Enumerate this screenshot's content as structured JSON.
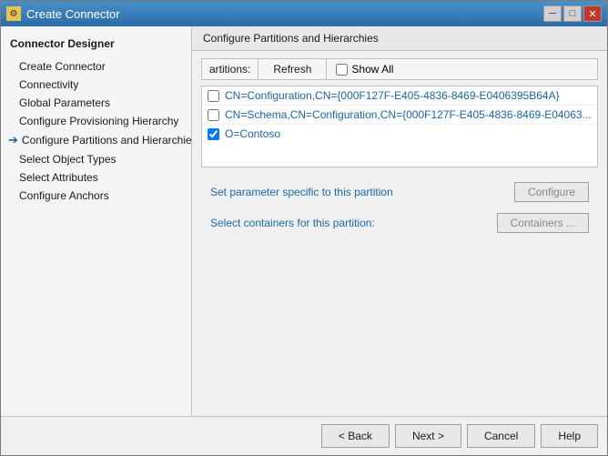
{
  "window": {
    "title": "Create Connector",
    "icon": "⚙"
  },
  "titlebar": {
    "minimize": "─",
    "maximize": "□",
    "close": "✕"
  },
  "sidebar": {
    "header": "Connector Designer",
    "items": [
      {
        "id": "create-connector",
        "label": "Create Connector",
        "indent": false,
        "active": false
      },
      {
        "id": "connectivity",
        "label": "Connectivity",
        "indent": true,
        "active": false
      },
      {
        "id": "global-parameters",
        "label": "Global Parameters",
        "indent": true,
        "active": false
      },
      {
        "id": "configure-provisioning",
        "label": "Configure Provisioning Hierarchy",
        "indent": true,
        "active": false
      },
      {
        "id": "configure-partitions",
        "label": "Configure Partitions and Hierarchies",
        "indent": true,
        "active": true,
        "current": true
      },
      {
        "id": "select-object-types",
        "label": "Select Object Types",
        "indent": true,
        "active": false
      },
      {
        "id": "select-attributes",
        "label": "Select Attributes",
        "indent": true,
        "active": false
      },
      {
        "id": "configure-anchors",
        "label": "Configure Anchors",
        "indent": true,
        "active": false
      }
    ]
  },
  "content": {
    "header": "Configure Partitions and Hierarchies",
    "partitions_label": "artitions:",
    "refresh_btn": "Refresh",
    "show_all_label": "Show All",
    "partitions": [
      {
        "id": "p1",
        "checked": false,
        "label": "CN=Configuration,CN={000F127F-E405-4836-8469-E0406395B64A}"
      },
      {
        "id": "p2",
        "checked": false,
        "label": "CN=Schema,CN=Configuration,CN={000F127F-E405-4836-8469-E04063..."
      },
      {
        "id": "p3",
        "checked": true,
        "label": "O=Contoso"
      }
    ],
    "set_param_label": "Set parameter specific to this partition",
    "configure_btn": "Configure",
    "select_containers_label": "Select containers for this partition:",
    "containers_btn": "Containers ..."
  },
  "footer": {
    "back_btn": "< Back",
    "next_btn": "Next >",
    "cancel_btn": "Cancel",
    "help_btn": "Help"
  }
}
